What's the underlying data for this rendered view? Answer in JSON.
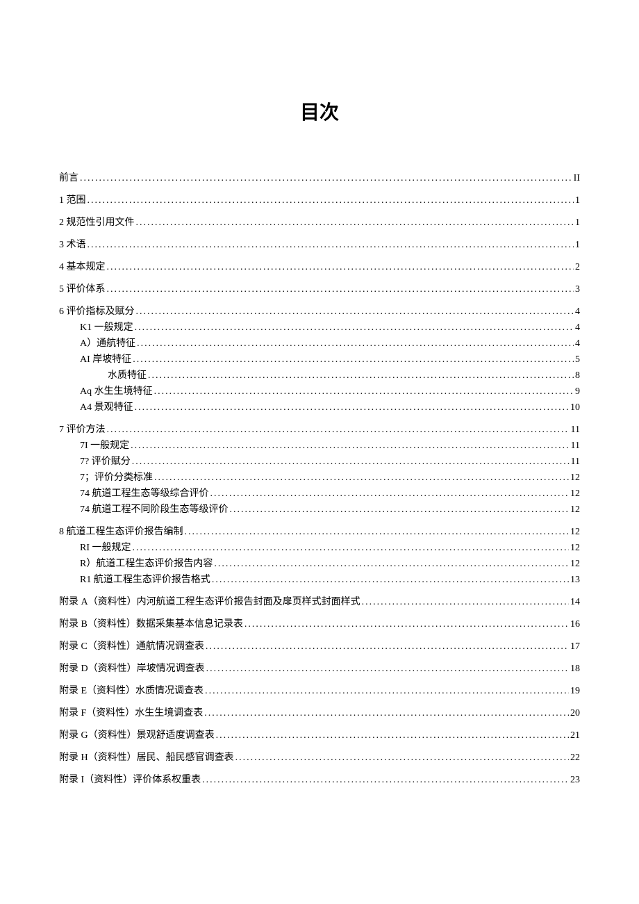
{
  "title": "目次",
  "entries": [
    {
      "label": "前言",
      "page": "II",
      "indent": 0,
      "tight": false,
      "gap": false
    },
    {
      "label": "1 范围",
      "page": "1",
      "indent": 0,
      "tight": false,
      "gap": false
    },
    {
      "label": "2 规范性引用文件",
      "page": "1",
      "indent": 0,
      "tight": false,
      "gap": false
    },
    {
      "label": "3 术语",
      "page": "1",
      "indent": 0,
      "tight": false,
      "gap": false
    },
    {
      "label": "4 基本规定",
      "page": "2",
      "indent": 0,
      "tight": false,
      "gap": false
    },
    {
      "label": "5 评价体系",
      "page": "3",
      "indent": 0,
      "tight": false,
      "gap": false
    },
    {
      "label": "6 评价指标及赋分",
      "page": "4",
      "indent": 0,
      "tight": true,
      "gap": false
    },
    {
      "label": "K1 一般规定",
      "page": "4",
      "indent": 1,
      "tight": true,
      "gap": false
    },
    {
      "label": "A）通航特征",
      "page": "4",
      "indent": 1,
      "tight": true,
      "gap": false
    },
    {
      "label": "AI 岸坡特征",
      "page": "5",
      "indent": 1,
      "tight": true,
      "gap": false
    },
    {
      "label": "水质特征",
      "page": "8",
      "indent": 2,
      "tight": true,
      "gap": false
    },
    {
      "label": "Aq 水生生境特征",
      "page": "9",
      "indent": 1,
      "tight": true,
      "gap": false
    },
    {
      "label": "A4 景观特征",
      "page": "10",
      "indent": 1,
      "tight": false,
      "gap": false
    },
    {
      "label": "7 评价方法",
      "page": "11",
      "indent": 0,
      "tight": true,
      "gap": true
    },
    {
      "label": "7I 一般规定",
      "page": "11",
      "indent": 1,
      "tight": true,
      "gap": false
    },
    {
      "label": "7? 评价赋分",
      "page": "11",
      "indent": 1,
      "tight": true,
      "gap": false
    },
    {
      "label": "7；评价分类标准",
      "page": "12",
      "indent": 1,
      "tight": true,
      "gap": false
    },
    {
      "label": "74 航道工程生态等级综合评价",
      "page": "12",
      "indent": 1,
      "tight": true,
      "gap": false
    },
    {
      "label": "74 航道工程不同阶段生态等级评价",
      "page": "12",
      "indent": 1,
      "tight": false,
      "gap": false
    },
    {
      "label": "8 航道工程生态评价报告编制",
      "page": "12",
      "indent": 0,
      "tight": true,
      "gap": true
    },
    {
      "label": "RI 一般规定",
      "page": "12",
      "indent": 1,
      "tight": true,
      "gap": false
    },
    {
      "label": "R）航道工程生态评价报告内容",
      "page": "12",
      "indent": 1,
      "tight": true,
      "gap": false
    },
    {
      "label": "R1 航道工程生态评价报告格式",
      "page": "13",
      "indent": 1,
      "tight": false,
      "gap": false
    },
    {
      "label": "附录 A（资料性）内河航道工程生态评价报告封面及扉页样式封面样式",
      "page": "14",
      "indent": 0,
      "tight": false,
      "gap": true
    },
    {
      "label": "附录 B（资料性）数据采集基本信息记录表",
      "page": "16",
      "indent": 0,
      "tight": false,
      "gap": false
    },
    {
      "label": "附录 C（资料性）通航情况调查表",
      "page": "17",
      "indent": 0,
      "tight": false,
      "gap": false
    },
    {
      "label": "附录 D（资料性）岸坡情况调查表",
      "page": "18",
      "indent": 0,
      "tight": false,
      "gap": false
    },
    {
      "label": "附录 E（资料性）水质情况调查表",
      "page": "19",
      "indent": 0,
      "tight": false,
      "gap": false
    },
    {
      "label": "附录 F（资料性）水生生境调查表",
      "page": "20",
      "indent": 0,
      "tight": false,
      "gap": false
    },
    {
      "label": "附录 G（资料性）景观舒适度调查表",
      "page": "21",
      "indent": 0,
      "tight": false,
      "gap": false
    },
    {
      "label": "附录 H（资料性）居民、船民感官调查表",
      "page": "22",
      "indent": 0,
      "tight": false,
      "gap": false
    },
    {
      "label": "附录 I（资料性）评价体系权重表",
      "page": "23",
      "indent": 0,
      "tight": false,
      "gap": false
    }
  ]
}
